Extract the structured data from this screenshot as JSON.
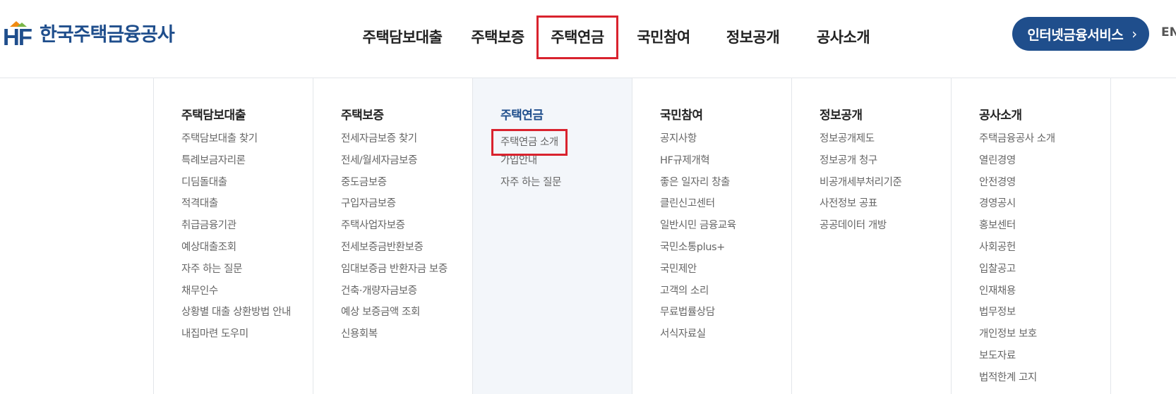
{
  "logo": {
    "mark": "HF",
    "name": "한국주택금융공사"
  },
  "gnb": [
    {
      "label": "주택담보대출"
    },
    {
      "label": "주택보증"
    },
    {
      "label": "주택연금",
      "active": true
    },
    {
      "label": "국민참여"
    },
    {
      "label": "정보공개"
    },
    {
      "label": "공사소개"
    }
  ],
  "header_actions": {
    "internet_service": "인터넷금융서비스",
    "chevron": "›",
    "lang": "EN"
  },
  "mega_menu": [
    {
      "title": "주택담보대출",
      "items": [
        "주택담보대출 찾기",
        "특례보금자리론",
        "디딤돌대출",
        "적격대출",
        "취급금융기관",
        "예상대출조회",
        "자주 하는 질문",
        "채무인수",
        "상황별 대출 상환방법 안내",
        "내집마련 도우미"
      ]
    },
    {
      "title": "주택보증",
      "items": [
        "전세자금보증 찾기",
        "전세/월세자금보증",
        "중도금보증",
        "구입자금보증",
        "주택사업자보증",
        "전세보증금반환보증",
        "임대보증금 반환자금 보증",
        "건축·개량자금보증",
        "예상 보증금액 조회",
        "신용회복"
      ]
    },
    {
      "title": "주택연금",
      "active": true,
      "items": [
        "주택연금 소개",
        "가입안내",
        "자주 하는 질문"
      ]
    },
    {
      "title": "국민참여",
      "items": [
        "공지사항",
        "HF규제개혁",
        "좋은 일자리 창출",
        "클린신고센터",
        "일반시민 금융교육",
        "국민소통plus+",
        "국민제안",
        "고객의 소리",
        "무료법률상담",
        "서식자료실"
      ]
    },
    {
      "title": "정보공개",
      "items": [
        "정보공개제도",
        "정보공개 청구",
        "비공개세부처리기준",
        "사전정보 공표",
        "공공데이터 개방"
      ]
    },
    {
      "title": "공사소개",
      "items": [
        "주택금융공사 소개",
        "열린경영",
        "안전경영",
        "경영공시",
        "홍보센터",
        "사회공헌",
        "입찰공고",
        "인재채용",
        "법무정보",
        "개인정보 보호",
        "보도자료",
        "법적한계 고지"
      ]
    }
  ],
  "colors": {
    "brand": "#1f4e8c",
    "highlight": "#d9232e",
    "active_bg": "#f3f6fa"
  }
}
